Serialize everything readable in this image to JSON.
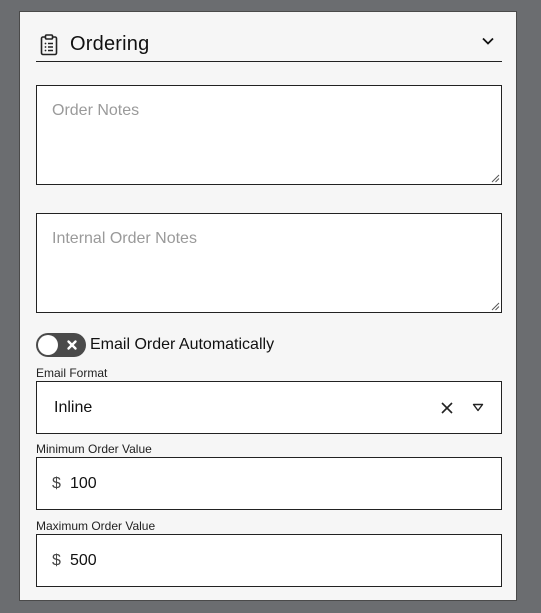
{
  "section": {
    "title": "Ordering",
    "icon": "clipboard-list-icon",
    "expanded": true
  },
  "order_notes": {
    "placeholder": "Order Notes",
    "value": ""
  },
  "internal_order_notes": {
    "placeholder": "Internal Order Notes",
    "value": ""
  },
  "email_auto": {
    "label": "Email Order Automatically",
    "enabled": false
  },
  "email_format": {
    "label": "Email Format",
    "value": "Inline"
  },
  "min_order": {
    "label": "Minimum Order Value",
    "currency": "$",
    "value": "100"
  },
  "max_order": {
    "label": "Maximum Order Value",
    "currency": "$",
    "value": "500"
  },
  "colors": {
    "backdrop": "#6b6d70",
    "panel": "#f6f6f6",
    "toggle_off": "#4a4a4a"
  }
}
